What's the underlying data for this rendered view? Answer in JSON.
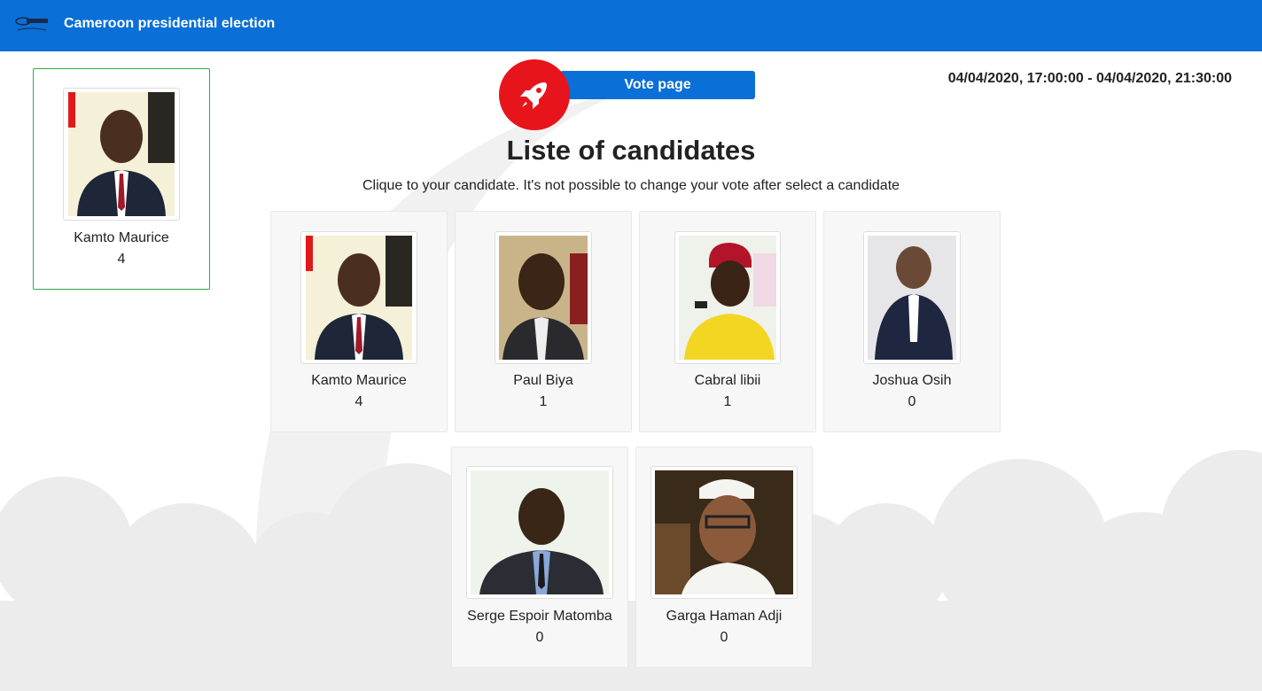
{
  "app": {
    "brand": "Cameroon presidential election",
    "logo_icon": "ballot-logo-icon"
  },
  "header": {
    "vote_page_label": "Vote page",
    "rocket_icon": "rocket-icon",
    "dates": "04/04/2020, 17:00:00 - 04/04/2020, 21:30:00",
    "title": "Liste of candidates",
    "subtitle": "Clique to your candidate. It's not possible to change your vote after select a candidate"
  },
  "leader": {
    "name": "Kamto Maurice",
    "votes": "4"
  },
  "candidates": [
    {
      "name": "Kamto Maurice",
      "votes": "4"
    },
    {
      "name": "Paul Biya",
      "votes": "1"
    },
    {
      "name": "Cabral libii",
      "votes": "1"
    },
    {
      "name": "Joshua Osih",
      "votes": "0"
    },
    {
      "name": "Serge Espoir Matomba",
      "votes": "0"
    },
    {
      "name": "Garga Haman Adji",
      "votes": "0"
    }
  ],
  "colors": {
    "navbar": "#0a6fd6",
    "rocket_badge": "#e8141c",
    "leader_border": "#2eaa4a",
    "card_bg": "#f7f7f7"
  }
}
